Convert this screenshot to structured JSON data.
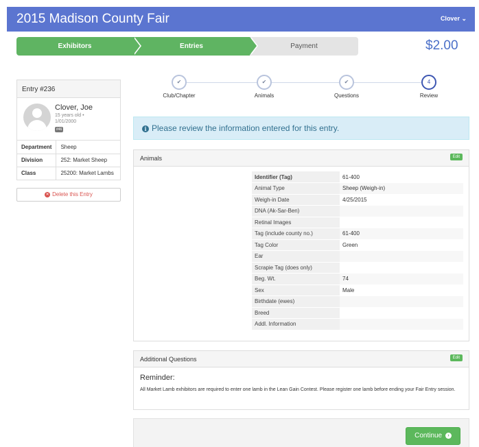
{
  "header": {
    "title": "2015 Madison County Fair",
    "user_menu": "Clover ⌄"
  },
  "wizard_tabs": [
    "Exhibitors",
    "Entries",
    "Payment"
  ],
  "total": "$2.00",
  "entry": {
    "heading": "Entry #236",
    "name": "Clover, Joe",
    "age": "15 years old •",
    "dob": "1/01/2000",
    "badge": "#46",
    "rows": [
      {
        "label": "Department",
        "value": "Sheep"
      },
      {
        "label": "Division",
        "value": "252: Market Sheep"
      },
      {
        "label": "Class",
        "value": "25200: Market Lambs"
      }
    ],
    "delete_label": "Delete this Entry"
  },
  "steps": [
    {
      "label": "Club/Chapter",
      "mark": "✔"
    },
    {
      "label": "Animals",
      "mark": "✔"
    },
    {
      "label": "Questions",
      "mark": "✔"
    },
    {
      "label": "Review",
      "mark": "4"
    }
  ],
  "alert": "Please review the information entered for this entry.",
  "animals_panel": {
    "title": "Animals",
    "edit_label": "Edit",
    "rows": [
      {
        "label": "Identifier (Tag)",
        "value": "61-400"
      },
      {
        "label": "Animal Type",
        "value": "Sheep (Weigh-in)"
      },
      {
        "label": "Weigh-in Date",
        "value": "4/25/2015"
      },
      {
        "label": "DNA (Ak-Sar-Ben)",
        "value": ""
      },
      {
        "label": "Retinal Images",
        "value": ""
      },
      {
        "label": "Tag (include county no.)",
        "value": "61-400"
      },
      {
        "label": "Tag Color",
        "value": "Green"
      },
      {
        "label": "Ear",
        "value": ""
      },
      {
        "label": "Scrapie Tag (does only)",
        "value": ""
      },
      {
        "label": "Beg. Wt.",
        "value": "74"
      },
      {
        "label": "Sex",
        "value": "Male"
      },
      {
        "label": "Birthdate (ewes)",
        "value": ""
      },
      {
        "label": "Breed",
        "value": ""
      },
      {
        "label": "Addl. Information",
        "value": ""
      }
    ]
  },
  "questions_panel": {
    "title": "Additional Questions",
    "edit_label": "Edit",
    "reminder_heading": "Reminder:",
    "reminder_text": "All Market Lamb exhibitors are required to enter one lamb in the Lean Gain Contest. Please register one lamb before ending your Fair Entry session."
  },
  "continue_label": "Continue"
}
